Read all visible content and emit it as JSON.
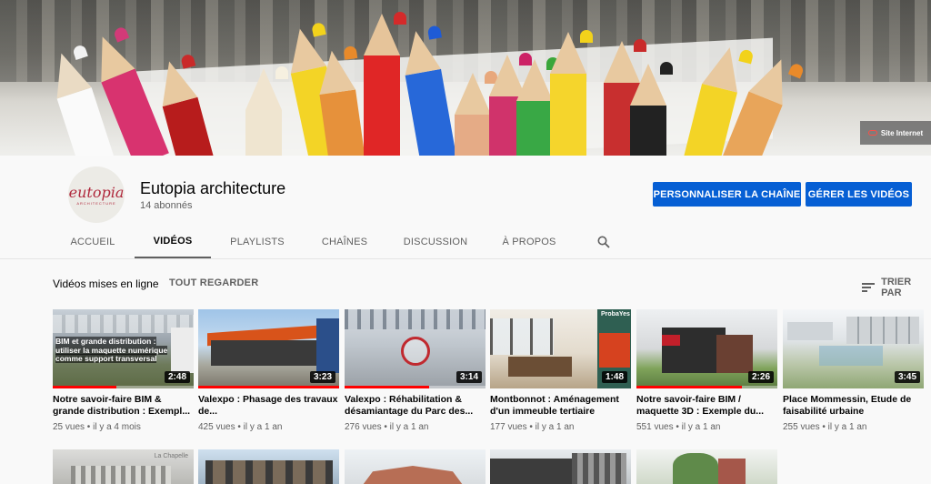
{
  "banner": {
    "site_link": "Site Internet"
  },
  "channel": {
    "name": "Eutopia architecture",
    "subscribers": "14 abonnés",
    "avatar_logo": "eutopia",
    "avatar_sub": "ARCHITECTURE",
    "customize_label": "PERSONNALISER LA CHAÎNE",
    "manage_label": "GÉRER LES VIDÉOS"
  },
  "tabs": [
    "ACCUEIL",
    "VIDÉOS",
    "PLAYLISTS",
    "CHAÎNES",
    "DISCUSSION",
    "À PROPOS"
  ],
  "section": {
    "title": "Vidéos mises en ligne",
    "see_all": "TOUT REGARDER",
    "sort": "TRIER PAR"
  },
  "videos": [
    {
      "title": "Notre savoir-faire BIM & grande distribution : Exempl...",
      "views": "25 vues",
      "age": "il y a 4 mois",
      "duration": "2:48",
      "watched": 0.45,
      "thumb_text": "BIM et grande distribution : utiliser la maquette numérique comme support transversal"
    },
    {
      "title": "Valexpo : Phasage des travaux de...",
      "views": "425 vues",
      "age": "il y a 1 an",
      "duration": "3:23",
      "watched": 1.0
    },
    {
      "title": "Valexpo : Réhabilitation & désamiantage du Parc des...",
      "views": "276 vues",
      "age": "il y a 1 an",
      "duration": "3:14",
      "watched": 0.6
    },
    {
      "title": "Montbonnot : Aménagement d'un immeuble tertiaire",
      "views": "177 vues",
      "age": "il y a 1 an",
      "duration": "1:48",
      "watched": 0.0,
      "thumb_text": "ProbaYes"
    },
    {
      "title": "Notre savoir-faire BIM / maquette 3D : Exemple du...",
      "views": "551 vues",
      "age": "il y a 1 an",
      "duration": "2:26",
      "watched": 0.75
    },
    {
      "title": "Place Mommessin, Etude de faisabilité urbaine",
      "views": "255 vues",
      "age": "il y a 1 an",
      "duration": "3:45",
      "watched": 0.0
    }
  ],
  "row2": {
    "thumb_text": "La Chapelle"
  },
  "colors": {
    "accent": "#065fd4",
    "progress": "#ff0000",
    "brand": "#b0283c"
  }
}
